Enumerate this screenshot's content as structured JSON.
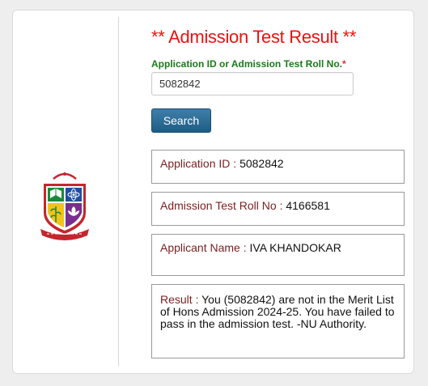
{
  "header": {
    "title": "** Admission Test Result **"
  },
  "form": {
    "label": "Application ID or Admission Test Roll No.",
    "required_mark": "*",
    "input_value": "5082842",
    "search_label": "Search"
  },
  "results": {
    "app_id": {
      "label": "Application ID :",
      "value": "5082842"
    },
    "roll": {
      "label": "Admission Test Roll No :",
      "value": "4166581"
    },
    "name": {
      "label": "Applicant Name :",
      "value": "IVA KHANDOKAR"
    },
    "result": {
      "label": "Result :",
      "value": "You (5082842) are not in the Merit List of Hons Admission 2024-25. You have failed to pass in the admission test. -NU Authority."
    }
  },
  "logo": {
    "icon": "national-university-logo",
    "colors": {
      "red": "#c4262e",
      "green": "#1a8a3a",
      "blue": "#1f4fa0",
      "yellow": "#f2c318"
    }
  }
}
